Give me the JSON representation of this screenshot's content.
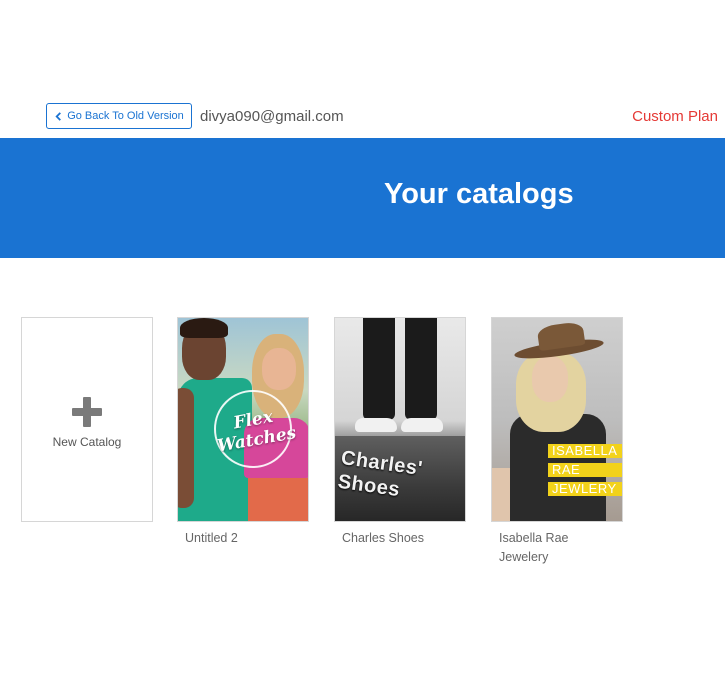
{
  "header": {
    "back_button_label": "Go Back To Old Version",
    "email": "divya090@gmail.com",
    "plan_label": "Custom Plan"
  },
  "hero": {
    "title": "Your catalogs",
    "background_color": "#1a73d2"
  },
  "new_catalog": {
    "label": "New Catalog",
    "icon": "plus-icon"
  },
  "catalogs": [
    {
      "name": "Untitled 2",
      "cover_text": "Flex Watches"
    },
    {
      "name": "Charles Shoes",
      "cover_text": "Charles' Shoes"
    },
    {
      "name": "Isabella Rae Jewelery",
      "cover_lines": [
        "ISABELLA",
        "RAE",
        "JEWLERY"
      ]
    }
  ],
  "colors": {
    "accent": "#1a73d2",
    "plan": "#e53935"
  }
}
